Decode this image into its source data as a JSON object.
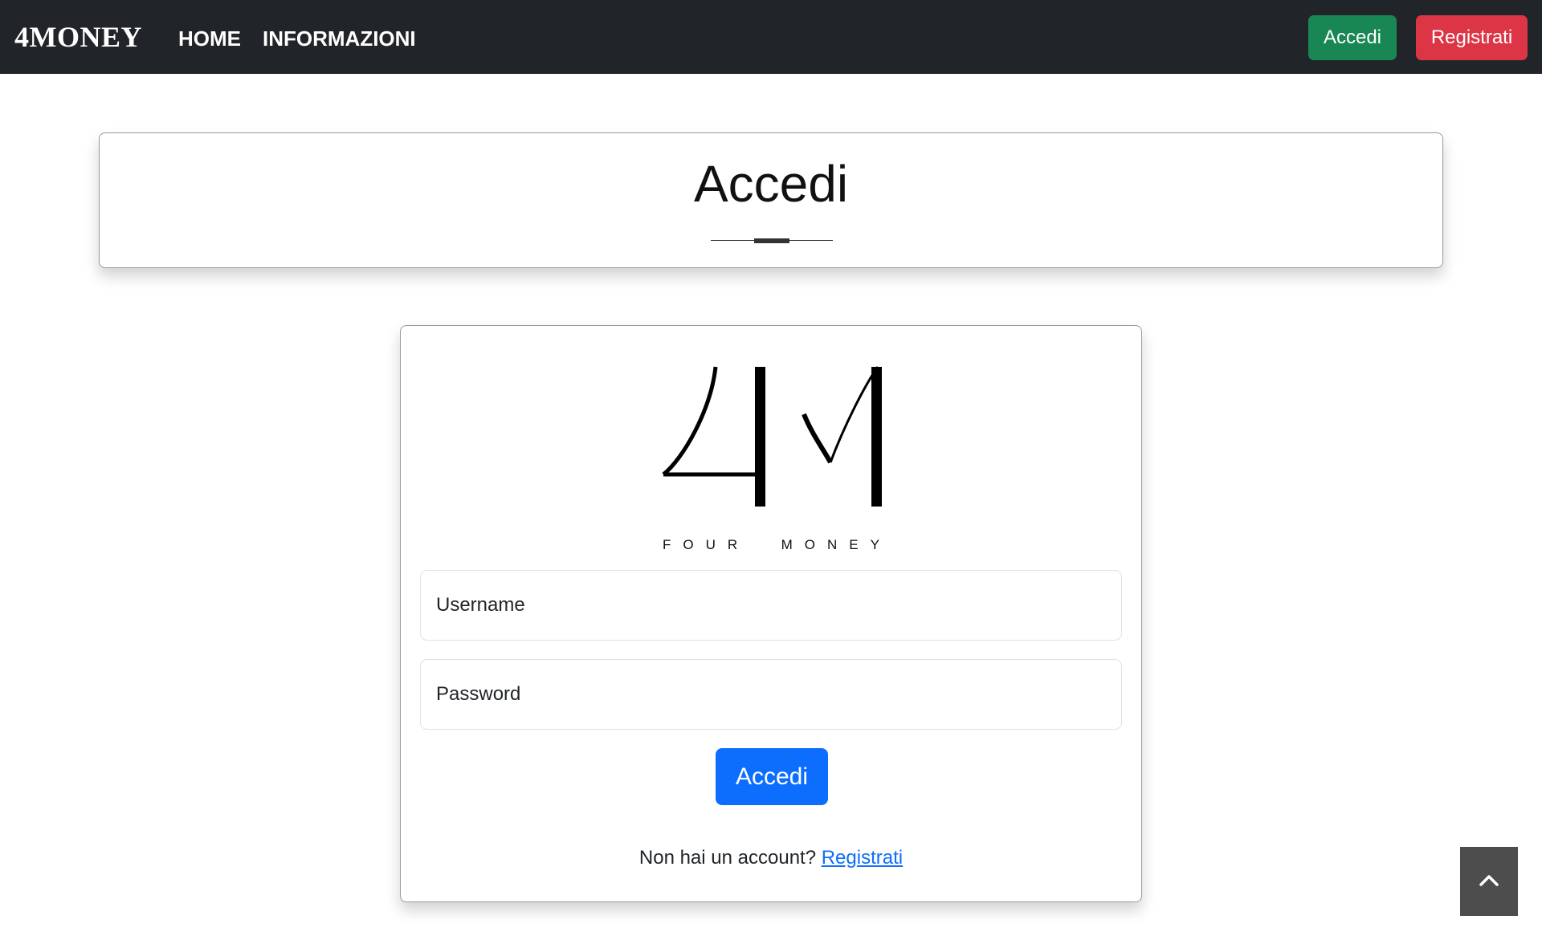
{
  "navbar": {
    "brand": "4MONEY",
    "links": [
      {
        "label": "HOME"
      },
      {
        "label": "INFORMAZIONI"
      }
    ],
    "login_label": "Accedi",
    "register_label": "Registrati",
    "colors": {
      "background": "#212529",
      "login": "#198754",
      "register": "#dc3545"
    }
  },
  "title_card": {
    "heading": "Accedi"
  },
  "login_card": {
    "logo_text": "4M",
    "logo_subtitle": "FOUR  MONEY",
    "username_label": "Username",
    "password_label": "Password",
    "submit_label": "Accedi",
    "signup_prompt": "Non hai un account?",
    "signup_link": "Registrati",
    "colors": {
      "submit": "#0d6efd",
      "link": "#0d6efd"
    }
  },
  "scroll_top": {
    "icon": "chevron-up-icon",
    "color": "#4d4d4d"
  }
}
